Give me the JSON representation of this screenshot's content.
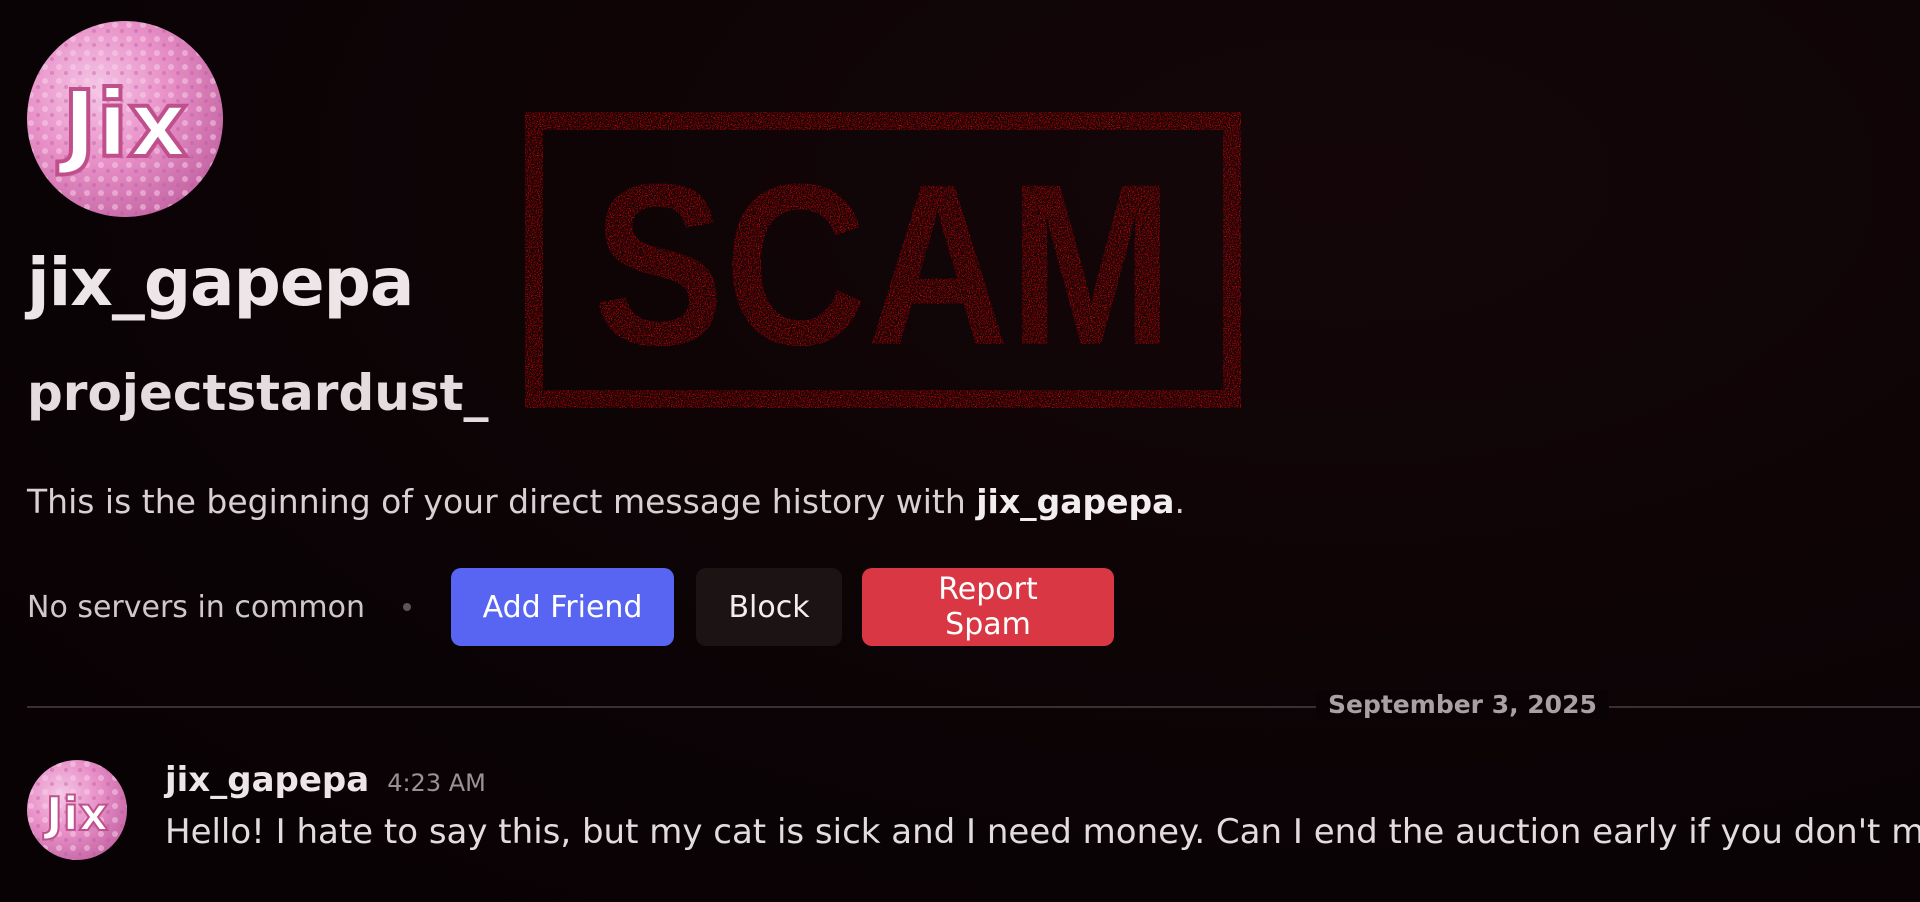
{
  "profile": {
    "display_name": "jix_gapepa",
    "username": "projectstardust_",
    "avatar_text": "Jix"
  },
  "intro": {
    "prefix": "This is the beginning of your direct message history with ",
    "name": "jix_gapepa",
    "suffix": "."
  },
  "actions": {
    "servers_text": "No servers in common",
    "add_friend_label": "Add Friend",
    "block_label": "Block",
    "report_spam_label": "Report Spam"
  },
  "overlay": {
    "stamp_text": "SCAM",
    "stamp_color": "#ff0000"
  },
  "colors": {
    "add_friend": "#5865f2",
    "report_spam": "#da3744",
    "block": "#1c1315"
  },
  "messages": {
    "date_separator": "September 3, 2025",
    "items": [
      {
        "author": "jix_gapepa",
        "time": "4:23 AM",
        "text": "Hello! I hate to say this, but my cat is sick and I need money. Can I end the auction early if you don't mind?"
      }
    ]
  }
}
